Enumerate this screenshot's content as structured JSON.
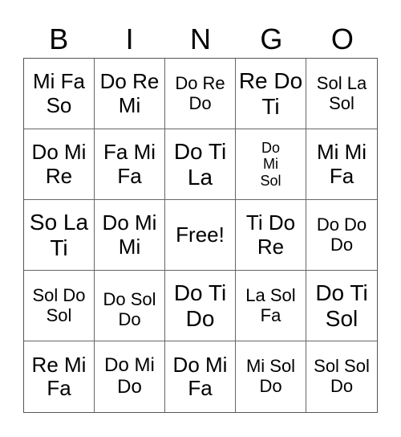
{
  "header": [
    "B",
    "I",
    "N",
    "G",
    "O"
  ],
  "cells": [
    [
      "Mi Fa So",
      "Do Re Mi",
      "Do Re Do",
      "Re Do Ti",
      "Sol La Sol"
    ],
    [
      "Do Mi Re",
      "Fa Mi Fa",
      "Do Ti La",
      "Do Mi Sol",
      "Mi Mi Fa"
    ],
    [
      "So La Ti",
      "Do Mi Mi",
      "Free!",
      "Ti Do Re",
      "Do Do Do"
    ],
    [
      "Sol Do Sol",
      "Do Sol Do",
      "Do Ti Do",
      "La Sol Fa",
      "Do Ti Sol"
    ],
    [
      "Re Mi Fa",
      "Do Mi Do",
      "Do Mi Fa",
      "Mi Sol Do",
      "Sol Sol Do"
    ]
  ]
}
